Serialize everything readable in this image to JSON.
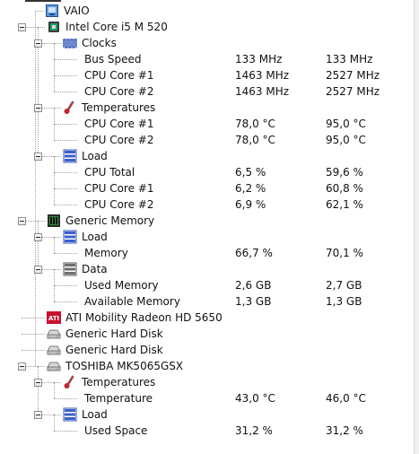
{
  "tree": {
    "rows": [
      {
        "label": "VAIO",
        "min": "",
        "max": "",
        "icon": "computer-icon"
      },
      {
        "label": "Intel Core i5 M 520",
        "min": "",
        "max": "",
        "icon": "cpu-icon"
      },
      {
        "label": "Clocks",
        "min": "",
        "max": "",
        "icon": "clock-icon"
      },
      {
        "label": "Bus Speed",
        "min": "133 MHz",
        "max": "133 MHz"
      },
      {
        "label": "CPU Core #1",
        "min": "1463 MHz",
        "max": "2527 MHz"
      },
      {
        "label": "CPU Core #2",
        "min": "1463 MHz",
        "max": "2527 MHz"
      },
      {
        "label": "Temperatures",
        "min": "",
        "max": "",
        "icon": "thermometer-icon"
      },
      {
        "label": "CPU Core #1",
        "min": "78,0 °C",
        "max": "95,0 °C"
      },
      {
        "label": "CPU Core #2",
        "min": "78,0 °C",
        "max": "95,0 °C"
      },
      {
        "label": "Load",
        "min": "",
        "max": "",
        "icon": "load-icon"
      },
      {
        "label": "CPU Total",
        "min": "6,5 %",
        "max": "59,6 %"
      },
      {
        "label": "CPU Core #1",
        "min": "6,2 %",
        "max": "60,8 %"
      },
      {
        "label": "CPU Core #2",
        "min": "6,9 %",
        "max": "62,1 %"
      },
      {
        "label": "Generic Memory",
        "min": "",
        "max": "",
        "icon": "memory-icon"
      },
      {
        "label": "Load",
        "min": "",
        "max": "",
        "icon": "load-icon"
      },
      {
        "label": "Memory",
        "min": "66,7 %",
        "max": "70,1 %"
      },
      {
        "label": "Data",
        "min": "",
        "max": "",
        "icon": "data-icon"
      },
      {
        "label": "Used Memory",
        "min": "2,6 GB",
        "max": "2,7 GB"
      },
      {
        "label": "Available Memory",
        "min": "1,3 GB",
        "max": "1,3 GB"
      },
      {
        "label": "ATI Mobility Radeon HD 5650",
        "min": "",
        "max": "",
        "icon": "ati-gpu-icon"
      },
      {
        "label": "Generic Hard Disk",
        "min": "",
        "max": "",
        "icon": "hard-disk-icon"
      },
      {
        "label": "Generic Hard Disk",
        "min": "",
        "max": "",
        "icon": "hard-disk-icon"
      },
      {
        "label": "TOSHIBA MK5065GSX",
        "min": "",
        "max": "",
        "icon": "hard-disk-icon"
      },
      {
        "label": "Temperatures",
        "min": "",
        "max": "",
        "icon": "thermometer-icon"
      },
      {
        "label": "Temperature",
        "min": "43,0 °C",
        "max": "46,0 °C"
      },
      {
        "label": "Load",
        "min": "",
        "max": "",
        "icon": "load-icon"
      },
      {
        "label": "Used Space",
        "min": "31,2 %",
        "max": "31,2 %"
      }
    ]
  },
  "colors": {
    "tree_line": "#a0a0a0",
    "load_icon": "#3a5fcd",
    "thermometer": "#c0262e",
    "ati_red": "#c8102e"
  }
}
